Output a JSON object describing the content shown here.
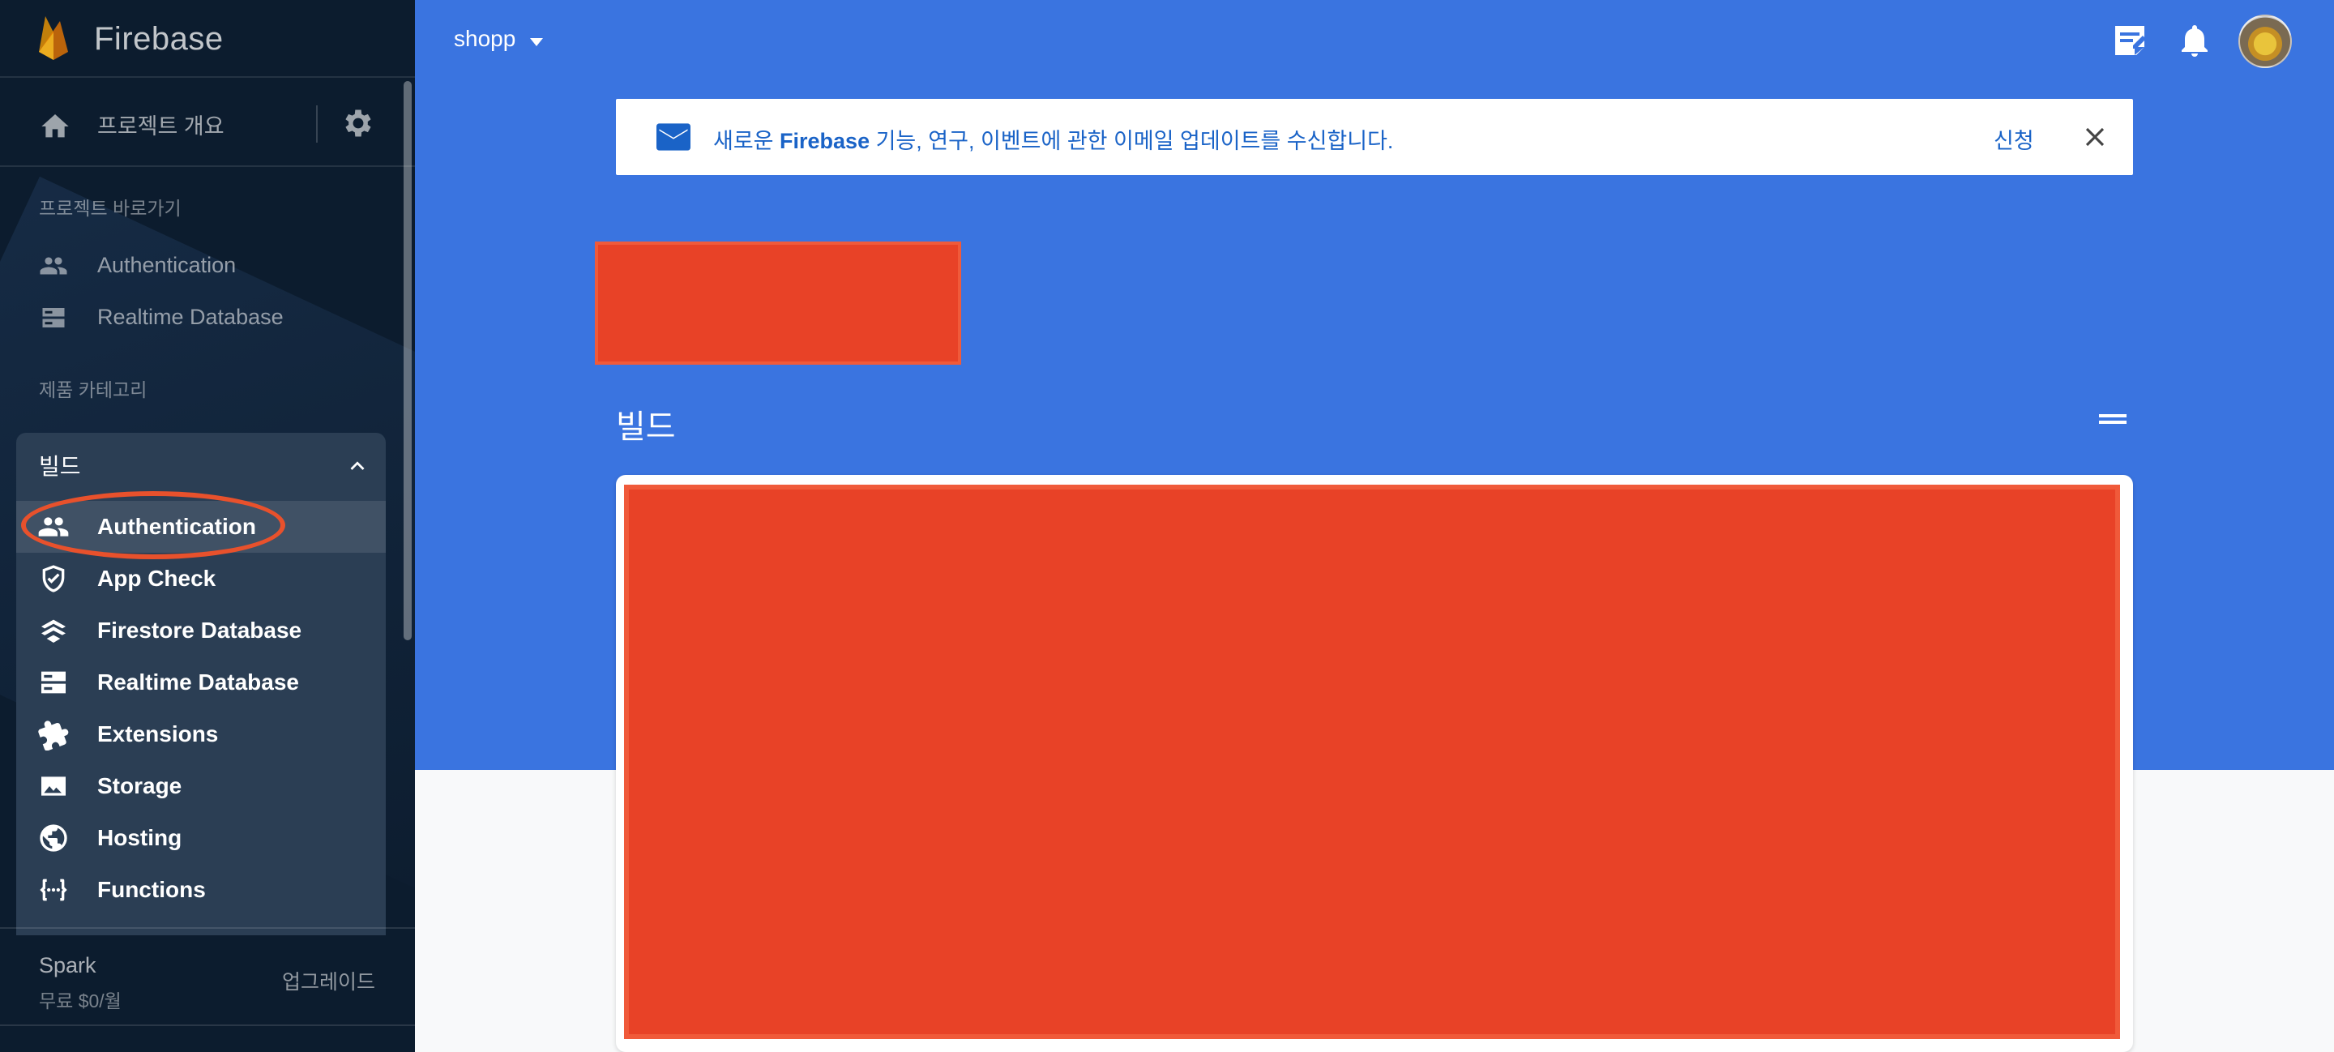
{
  "app": {
    "brand": "Firebase",
    "project_name": "shopp"
  },
  "sidebar": {
    "overview_label": "프로젝트 개요",
    "shortcuts_title": "프로젝트 바로가기",
    "shortcuts": [
      {
        "label": "Authentication",
        "icon": "people-icon"
      },
      {
        "label": "Realtime Database",
        "icon": "database-icon"
      }
    ],
    "categories_title": "제품 카테고리",
    "build_section": {
      "title": "빌드",
      "expanded": true,
      "items": [
        {
          "label": "Authentication",
          "icon": "people-icon",
          "active": true
        },
        {
          "label": "App Check",
          "icon": "shield-check-icon"
        },
        {
          "label": "Firestore Database",
          "icon": "firestore-icon"
        },
        {
          "label": "Realtime Database",
          "icon": "database-icon"
        },
        {
          "label": "Extensions",
          "icon": "extension-icon"
        },
        {
          "label": "Storage",
          "icon": "image-icon"
        },
        {
          "label": "Hosting",
          "icon": "globe-icon"
        },
        {
          "label": "Functions",
          "icon": "functions-icon"
        }
      ]
    },
    "plan": {
      "name": "Spark",
      "price": "무료 $0/월",
      "upgrade_label": "업그레이드"
    }
  },
  "banner": {
    "text_before": "새로운 ",
    "text_brand": "Firebase",
    "text_after": " 기능, 연구, 이벤트에 관한 이메일 업데이트를 수신합니다.",
    "action_label": "신청"
  },
  "main": {
    "section_title": "빌드"
  },
  "colors": {
    "sidebar_bg": "#0c1c2e",
    "hero_blue": "#3a74e0",
    "redaction": "#e84227",
    "highlight": "#e8512c",
    "link_blue": "#1a63c7"
  }
}
